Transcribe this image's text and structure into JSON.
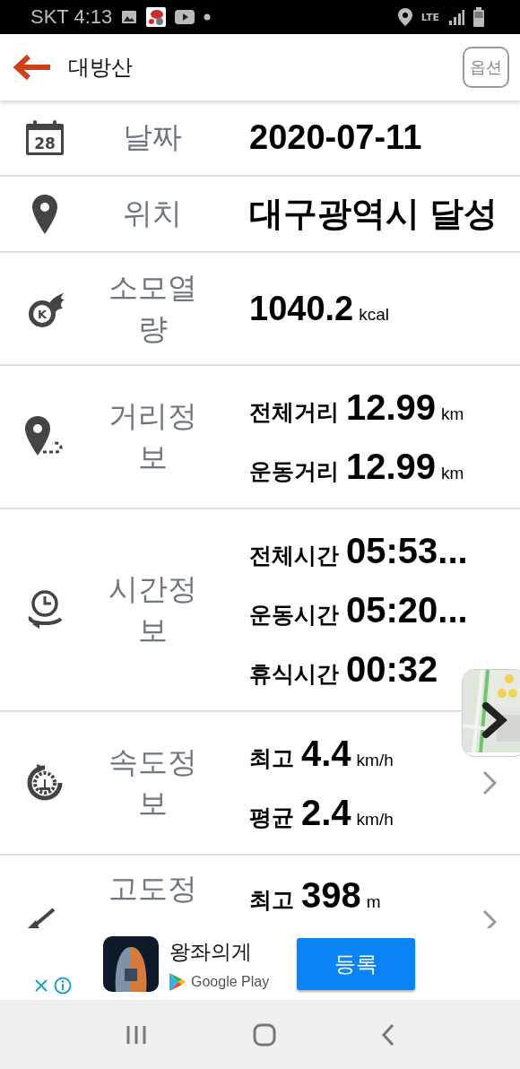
{
  "status_bar": {
    "carrier_time": "SKT 4:13",
    "network": "LTE"
  },
  "app_bar": {
    "title": "대방산",
    "option_button": "옵션"
  },
  "rows": [
    {
      "kind": "single",
      "calendar_day": "28",
      "label": "날짜",
      "value": "2020-07-11"
    },
    {
      "kind": "single",
      "label": "위치",
      "value": "대구광역시 달성"
    },
    {
      "kind": "unit",
      "calorie_mark": "K",
      "label": "소모열량",
      "value": "1040.2",
      "unit": "kcal"
    },
    {
      "kind": "multi",
      "label": "거리정보",
      "lines": [
        {
          "label": "전체거리",
          "value": "12.99",
          "unit": "km"
        },
        {
          "label": "운동거리",
          "value": "12.99",
          "unit": "km"
        }
      ]
    },
    {
      "kind": "multi",
      "label": "시간정보",
      "lines": [
        {
          "label": "전체시간",
          "value": "05:53..."
        },
        {
          "label": "운동시간",
          "value": "05:20..."
        },
        {
          "label": "휴식시간",
          "value": "00:32"
        }
      ]
    },
    {
      "kind": "link",
      "label": "속도정보",
      "lines": [
        {
          "label": "최고",
          "value": "4.4",
          "unit": "km/h"
        },
        {
          "label": "평균",
          "value": "2.4",
          "unit": "km/h"
        }
      ]
    },
    {
      "kind": "link",
      "label": "고도정",
      "lines": [
        {
          "label": "최고",
          "value": "398",
          "unit": "m"
        }
      ]
    }
  ],
  "ad": {
    "title": "왕좌의게",
    "store": "Google Play",
    "button": "등록"
  }
}
